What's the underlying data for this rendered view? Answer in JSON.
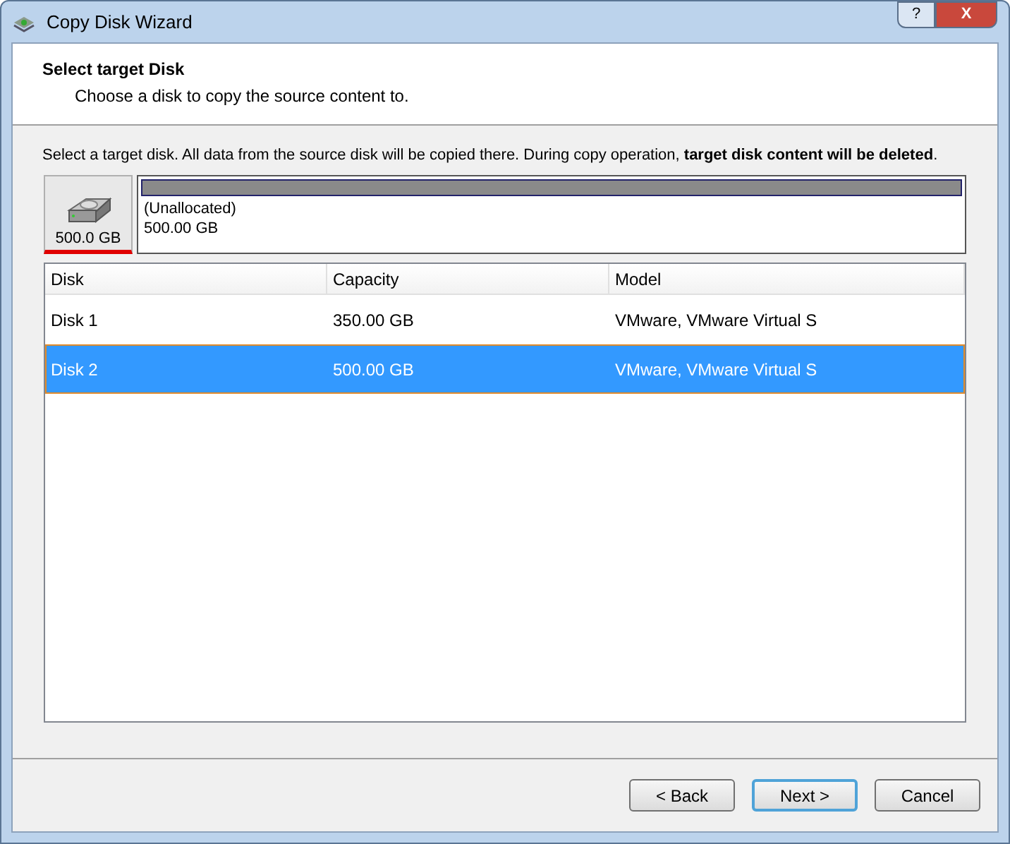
{
  "window": {
    "title": "Copy Disk Wizard",
    "controls": [
      "?",
      "X"
    ]
  },
  "header": {
    "title": "Select target Disk",
    "subtitle": "Choose a disk to copy the source content to."
  },
  "instruction": "Select a target disk. All data from the source disk will be copied there. During copy operation, **target disk content will be deleted**.",
  "disk_map": {
    "disk": {
      "size": "500.0 GB",
      "selected": true
    },
    "partitions": [
      {
        "label": "(Unallocated)",
        "size": "500.00 GB"
      }
    ]
  },
  "table": {
    "columns": [
      "Disk",
      "Capacity",
      "Model"
    ],
    "rows": [
      {
        "cells": [
          "Disk 1",
          "350.00 GB",
          "VMware, VMware Virtual S"
        ],
        "selected": false
      },
      {
        "cells": [
          "Disk 2",
          "500.00 GB",
          "VMware, VMware Virtual S"
        ],
        "selected": true
      }
    ]
  },
  "buttons": [
    {
      "label": "< Back",
      "default": false
    },
    {
      "label": "Next >",
      "default": true
    },
    {
      "label": "Cancel",
      "default": false
    }
  ]
}
